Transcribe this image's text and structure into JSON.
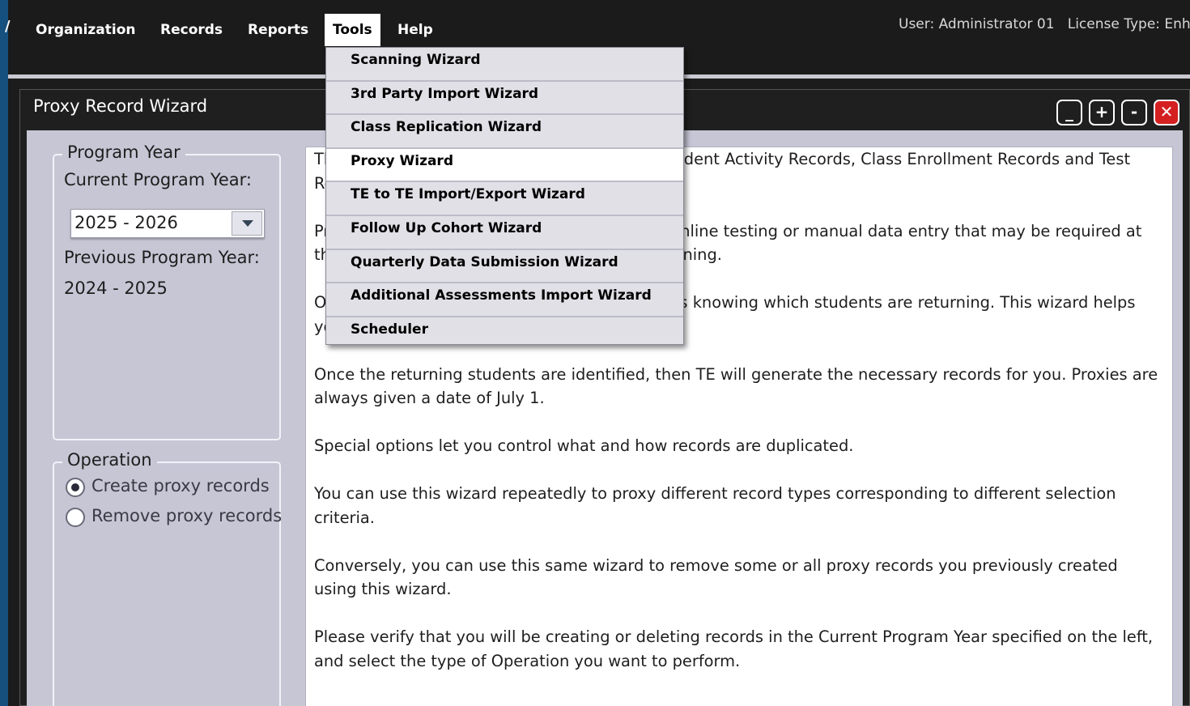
{
  "menubar": {
    "left_glyph": "/",
    "items": [
      {
        "label": "Organization"
      },
      {
        "label": "Records"
      },
      {
        "label": "Reports"
      },
      {
        "label": "Tools"
      },
      {
        "label": "Help"
      }
    ],
    "user_text": "User: Administrator 01",
    "license_text": "License Type: Enha"
  },
  "window": {
    "title": "Proxy Record Wizard",
    "buttons": [
      "_",
      "+",
      "-",
      "✕"
    ]
  },
  "program_year": {
    "group_label": "Program Year",
    "current_label": "Current Program Year:",
    "current_value": "2025 - 2026",
    "previous_label": "Previous Program Year:",
    "previous_value": "2024 - 2025"
  },
  "operation": {
    "group_label": "Operation",
    "options": [
      {
        "label": "Create proxy records",
        "checked": true
      },
      {
        "label": "Remove proxy records",
        "checked": false
      }
    ]
  },
  "description": {
    "paragraphs": [
      "This wizard assists you in generating proxy Student Activity Records, Class Enrollment Records and Test Records.",
      "Proxy records are records used for reporting, online testing or manual data entry that may be required at the start of the year for students who are returning.",
      "One of the challenges at the start of the year is knowing which students are returning. This wizard helps you by identifying those students.",
      "Once the returning students are identified, then TE will generate the necessary records for you. Proxies are always given a date of July 1.",
      "Special options let you control what and how records are duplicated.",
      "You can use this wizard repeatedly to proxy different record types corresponding to different selection criteria.",
      "Conversely, you can use this same wizard to remove some or all proxy records you previously created using this wizard.",
      "Please verify that you will be creating or deleting records in the Current Program Year specified on the left, and select the type of Operation you want to perform."
    ]
  },
  "tools_menu": {
    "items": [
      {
        "label": "Scanning Wizard"
      },
      {
        "label": "3rd Party Import Wizard"
      },
      {
        "label": "Class Replication Wizard"
      },
      {
        "label": "Proxy Wizard"
      },
      {
        "label": "TE to TE Import/Export Wizard"
      },
      {
        "label": "Follow Up Cohort Wizard"
      },
      {
        "label": "Quarterly Data Submission Wizard"
      },
      {
        "label": "Additional Assessments Import Wizard"
      },
      {
        "label": "Scheduler"
      }
    ],
    "highlighted": "Proxy Wizard"
  }
}
